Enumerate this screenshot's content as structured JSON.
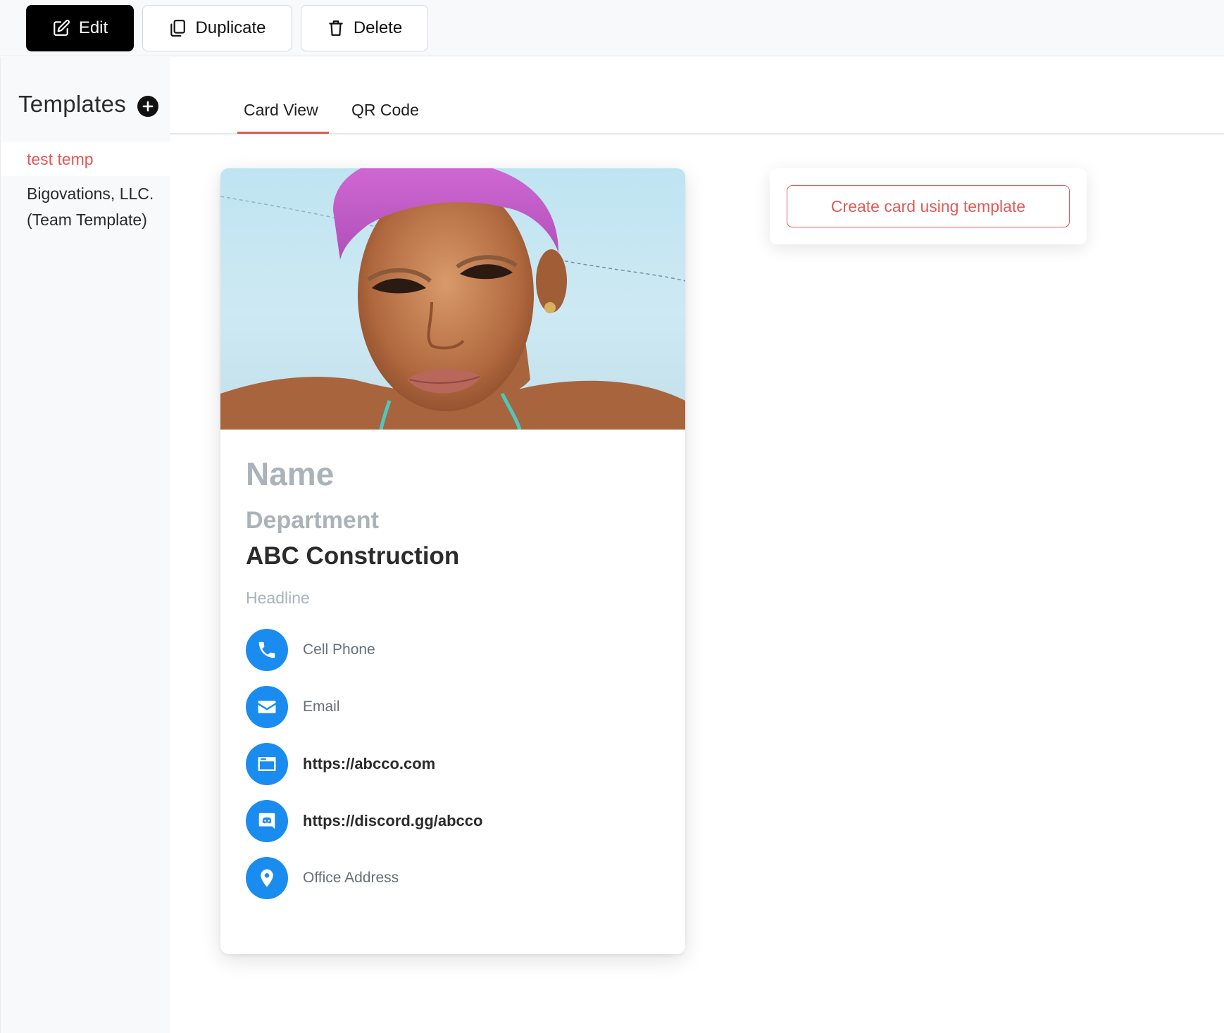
{
  "toolbar": {
    "edit_label": "Edit",
    "duplicate_label": "Duplicate",
    "delete_label": "Delete"
  },
  "sidebar": {
    "title": "Templates",
    "items": [
      {
        "label": "test temp",
        "active": true
      },
      {
        "label": "Bigovations, LLC. (Team Template)",
        "active": false
      }
    ]
  },
  "tabs": [
    {
      "label": "Card View",
      "active": true
    },
    {
      "label": "QR Code",
      "active": false
    }
  ],
  "card": {
    "name": "Name",
    "department": "Department",
    "company": "ABC Construction",
    "headline": "Headline",
    "contacts": [
      {
        "icon": "phone-icon",
        "text": "Cell Phone"
      },
      {
        "icon": "email-icon",
        "text": "Email"
      },
      {
        "icon": "website-icon",
        "text": "https://abcco.com"
      },
      {
        "icon": "discord-icon",
        "text": "https://discord.gg/abcco"
      },
      {
        "icon": "location-pin-icon",
        "text": "Office Address"
      }
    ]
  },
  "actions": {
    "create_card_label": "Create card using template"
  },
  "colors": {
    "accent": "#e05a55",
    "icon_blue": "#1a8cf0",
    "placeholder_gray": "#a9b3b9"
  }
}
